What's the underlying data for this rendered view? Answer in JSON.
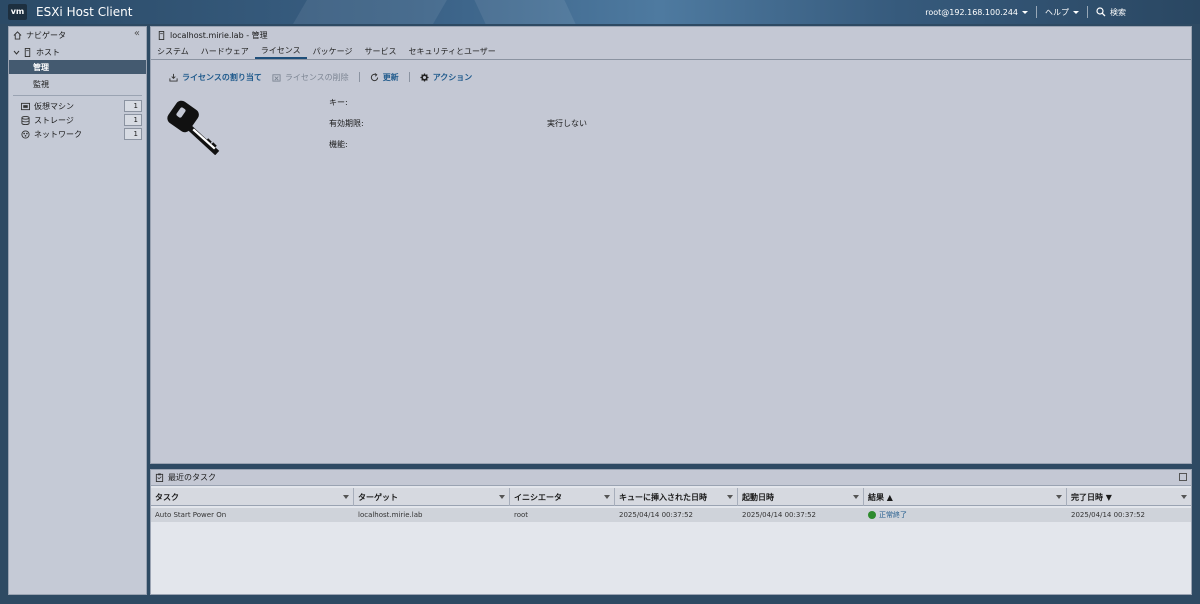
{
  "header": {
    "logo": "vm",
    "title": "ESXi Host Client",
    "user": "root@192.168.100.244",
    "help": "ヘルプ",
    "search": "検索"
  },
  "navigator": {
    "title": "ナビゲータ",
    "host": "ホスト",
    "manage": "管理",
    "monitor": "監視",
    "items": [
      {
        "label": "仮想マシン",
        "count": "1"
      },
      {
        "label": "ストレージ",
        "count": "1"
      },
      {
        "label": "ネットワーク",
        "count": "1"
      }
    ]
  },
  "main": {
    "breadcrumb": "localhost.mirie.lab - 管理",
    "tabs": [
      "システム",
      "ハードウェア",
      "ライセンス",
      "パッケージ",
      "サービス",
      "セキュリティとユーザー"
    ],
    "active_tab": 2,
    "toolbar": {
      "assign": "ライセンスの割り当て",
      "remove": "ライセンスの削除",
      "refresh": "更新",
      "actions": "アクション"
    },
    "license": {
      "key_label": "キー:",
      "expiry_label": "有効期限:",
      "expiry_value": "実行しない",
      "features_label": "機能:"
    }
  },
  "tasks": {
    "title": "最近のタスク",
    "columns": [
      "タスク",
      "ターゲット",
      "イニシエータ",
      "キューに挿入された日時",
      "起動日時",
      "結果 ▲",
      "完了日時 ▼"
    ],
    "rows": [
      {
        "task": "Auto Start Power On",
        "target": "localhost.mirie.lab",
        "initiator": "root",
        "queued": "2025/04/14 00:37:52",
        "started": "2025/04/14 00:37:52",
        "result": "正常終了",
        "completed": "2025/04/14 00:37:52"
      }
    ]
  },
  "colors": {
    "accent": "#1f5a8c",
    "selected_nav": "#445a70",
    "success": "#2e8b2e"
  }
}
